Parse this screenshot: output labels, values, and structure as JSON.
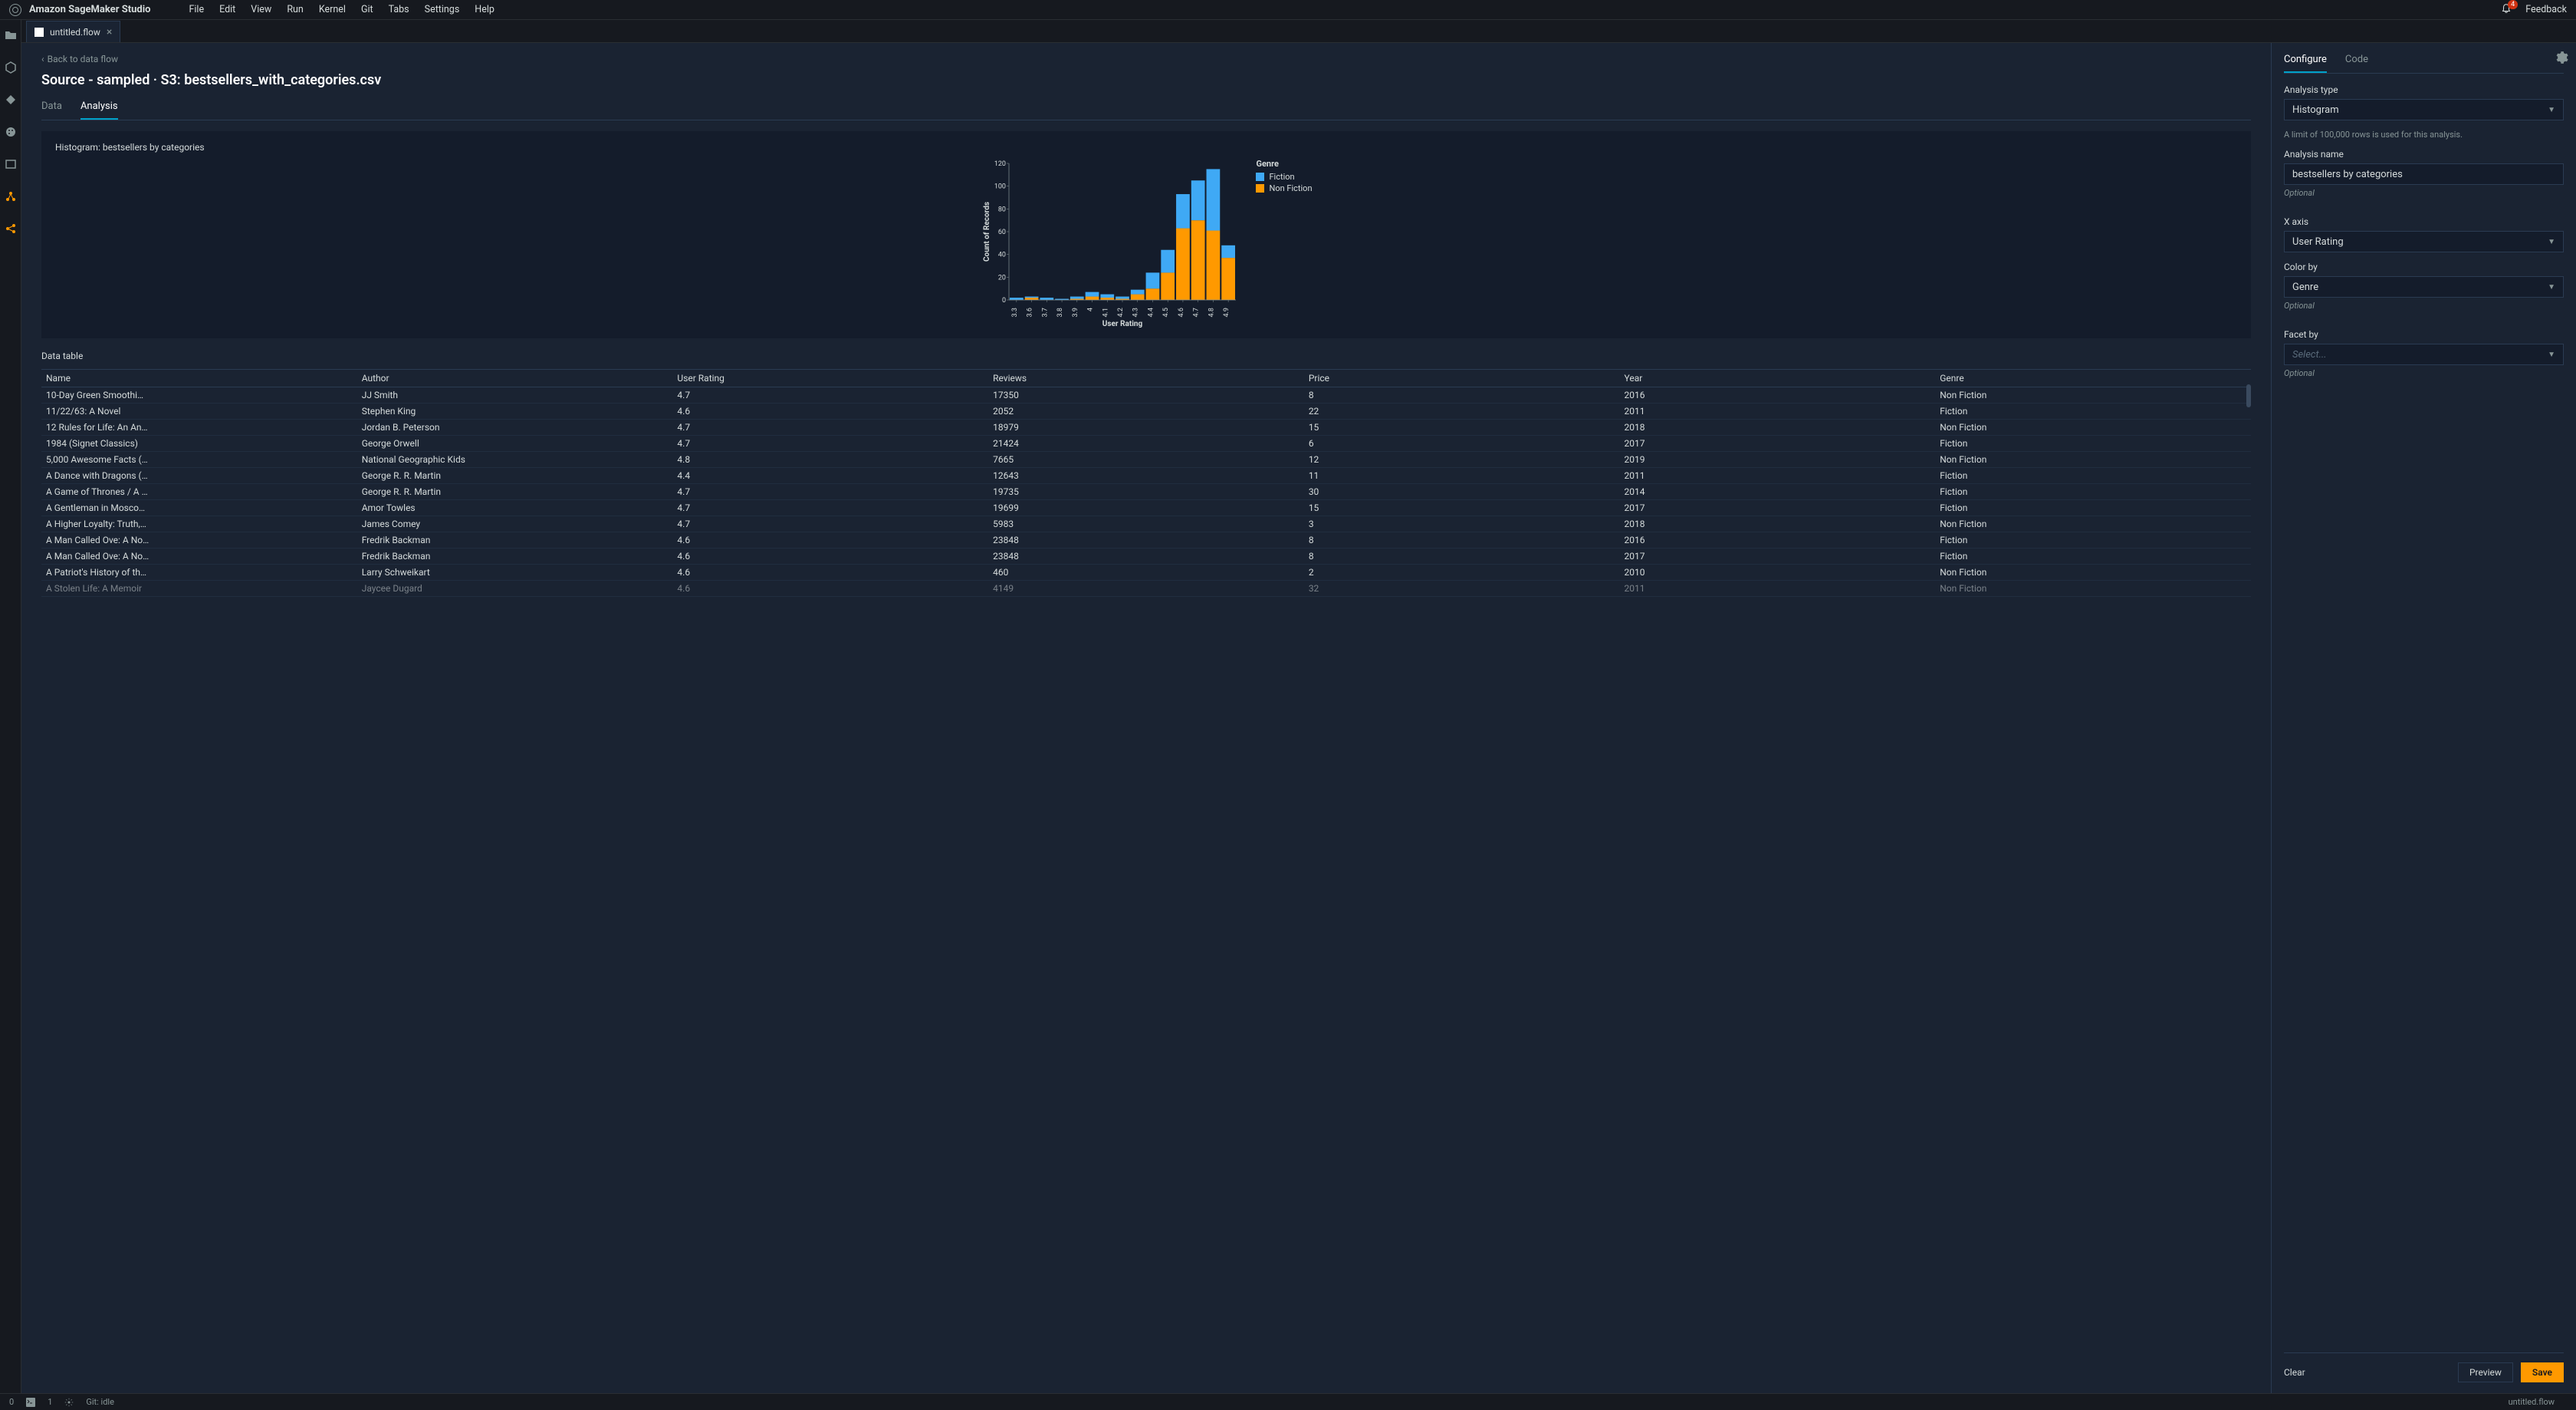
{
  "app_title": "Amazon SageMaker Studio",
  "menu": [
    "File",
    "Edit",
    "View",
    "Run",
    "Kernel",
    "Git",
    "Tabs",
    "Settings",
    "Help"
  ],
  "notifications_count": "4",
  "feedback_label": "Feedback",
  "tab": {
    "name": "untitled.flow"
  },
  "back_link": "Back to data flow",
  "page_title": "Source - sampled · S3: bestsellers_with_categories.csv",
  "content_tabs": {
    "data": "Data",
    "analysis": "Analysis"
  },
  "chart_title": "Histogram: bestsellers by categories",
  "legend": {
    "title": "Genre",
    "fiction": "Fiction",
    "nonfiction": "Non Fiction"
  },
  "axes": {
    "x": "User Rating",
    "y": "Count of Records"
  },
  "data_table_title": "Data table",
  "columns": [
    "Name",
    "Author",
    "User Rating",
    "Reviews",
    "Price",
    "Year",
    "Genre"
  ],
  "rows": [
    [
      "10-Day Green Smoothi…",
      "JJ Smith",
      "4.7",
      "17350",
      "8",
      "2016",
      "Non Fiction"
    ],
    [
      "11/22/63: A Novel",
      "Stephen King",
      "4.6",
      "2052",
      "22",
      "2011",
      "Fiction"
    ],
    [
      "12 Rules for Life: An An…",
      "Jordan B. Peterson",
      "4.7",
      "18979",
      "15",
      "2018",
      "Non Fiction"
    ],
    [
      "1984 (Signet Classics)",
      "George Orwell",
      "4.7",
      "21424",
      "6",
      "2017",
      "Fiction"
    ],
    [
      "5,000 Awesome Facts (…",
      "National Geographic Kids",
      "4.8",
      "7665",
      "12",
      "2019",
      "Non Fiction"
    ],
    [
      "A Dance with Dragons (…",
      "George R. R. Martin",
      "4.4",
      "12643",
      "11",
      "2011",
      "Fiction"
    ],
    [
      "A Game of Thrones / A …",
      "George R. R. Martin",
      "4.7",
      "19735",
      "30",
      "2014",
      "Fiction"
    ],
    [
      "A Gentleman in Mosco…",
      "Amor Towles",
      "4.7",
      "19699",
      "15",
      "2017",
      "Fiction"
    ],
    [
      "A Higher Loyalty: Truth,…",
      "James Comey",
      "4.7",
      "5983",
      "3",
      "2018",
      "Non Fiction"
    ],
    [
      "A Man Called Ove: A No…",
      "Fredrik Backman",
      "4.6",
      "23848",
      "8",
      "2016",
      "Fiction"
    ],
    [
      "A Man Called Ove: A No…",
      "Fredrik Backman",
      "4.6",
      "23848",
      "8",
      "2017",
      "Fiction"
    ],
    [
      "A Patriot's History of th…",
      "Larry Schweikart",
      "4.6",
      "460",
      "2",
      "2010",
      "Non Fiction"
    ],
    [
      "A Stolen Life: A Memoir",
      "Jaycee Dugard",
      "4.6",
      "4149",
      "32",
      "2011",
      "Non Fiction"
    ]
  ],
  "config": {
    "tabs": {
      "configure": "Configure",
      "code": "Code"
    },
    "analysis_type_label": "Analysis type",
    "analysis_type_value": "Histogram",
    "limit_note": "A limit of 100,000 rows is used for this analysis.",
    "analysis_name_label": "Analysis name",
    "analysis_name_value": "bestsellers by categories",
    "optional": "Optional",
    "x_axis_label": "X axis",
    "x_axis_value": "User Rating",
    "color_by_label": "Color by",
    "color_by_value": "Genre",
    "facet_by_label": "Facet by",
    "facet_placeholder": "Select...",
    "clear": "Clear",
    "preview": "Preview",
    "save": "Save"
  },
  "statusbar": {
    "zero": "0",
    "one": "1",
    "git": "Git: idle",
    "file": "untitled.flow"
  },
  "chart_data": {
    "type": "bar",
    "title": "Histogram: bestsellers by categories",
    "xlabel": "User Rating",
    "ylabel": "Count of Records",
    "ylim": [
      0,
      120
    ],
    "y_ticks": [
      0,
      20,
      40,
      60,
      80,
      100,
      120
    ],
    "x_ticks": [
      "3.3",
      "3.6",
      "3.7",
      "3.8",
      "3.9",
      "4",
      "4.1",
      "4.2",
      "4.3",
      "4.4",
      "4.5",
      "4.6",
      "4.7",
      "4.8",
      "4.9"
    ],
    "categories": [
      3.3,
      3.6,
      3.7,
      3.8,
      3.9,
      4.0,
      4.1,
      4.2,
      4.3,
      4.4,
      4.5,
      4.6,
      4.7,
      4.8,
      4.9
    ],
    "series": [
      {
        "name": "Non Fiction",
        "color": "#ff9900",
        "values": [
          0,
          2,
          0,
          0,
          1,
          3,
          2,
          1,
          5,
          10,
          24,
          63,
          70,
          61,
          37
        ]
      },
      {
        "name": "Fiction",
        "color": "#3fa9f5",
        "values": [
          2,
          1,
          2,
          1,
          2,
          4,
          3,
          2,
          4,
          14,
          20,
          30,
          35,
          54,
          11
        ]
      }
    ],
    "legend": [
      "Fiction",
      "Non Fiction"
    ]
  }
}
